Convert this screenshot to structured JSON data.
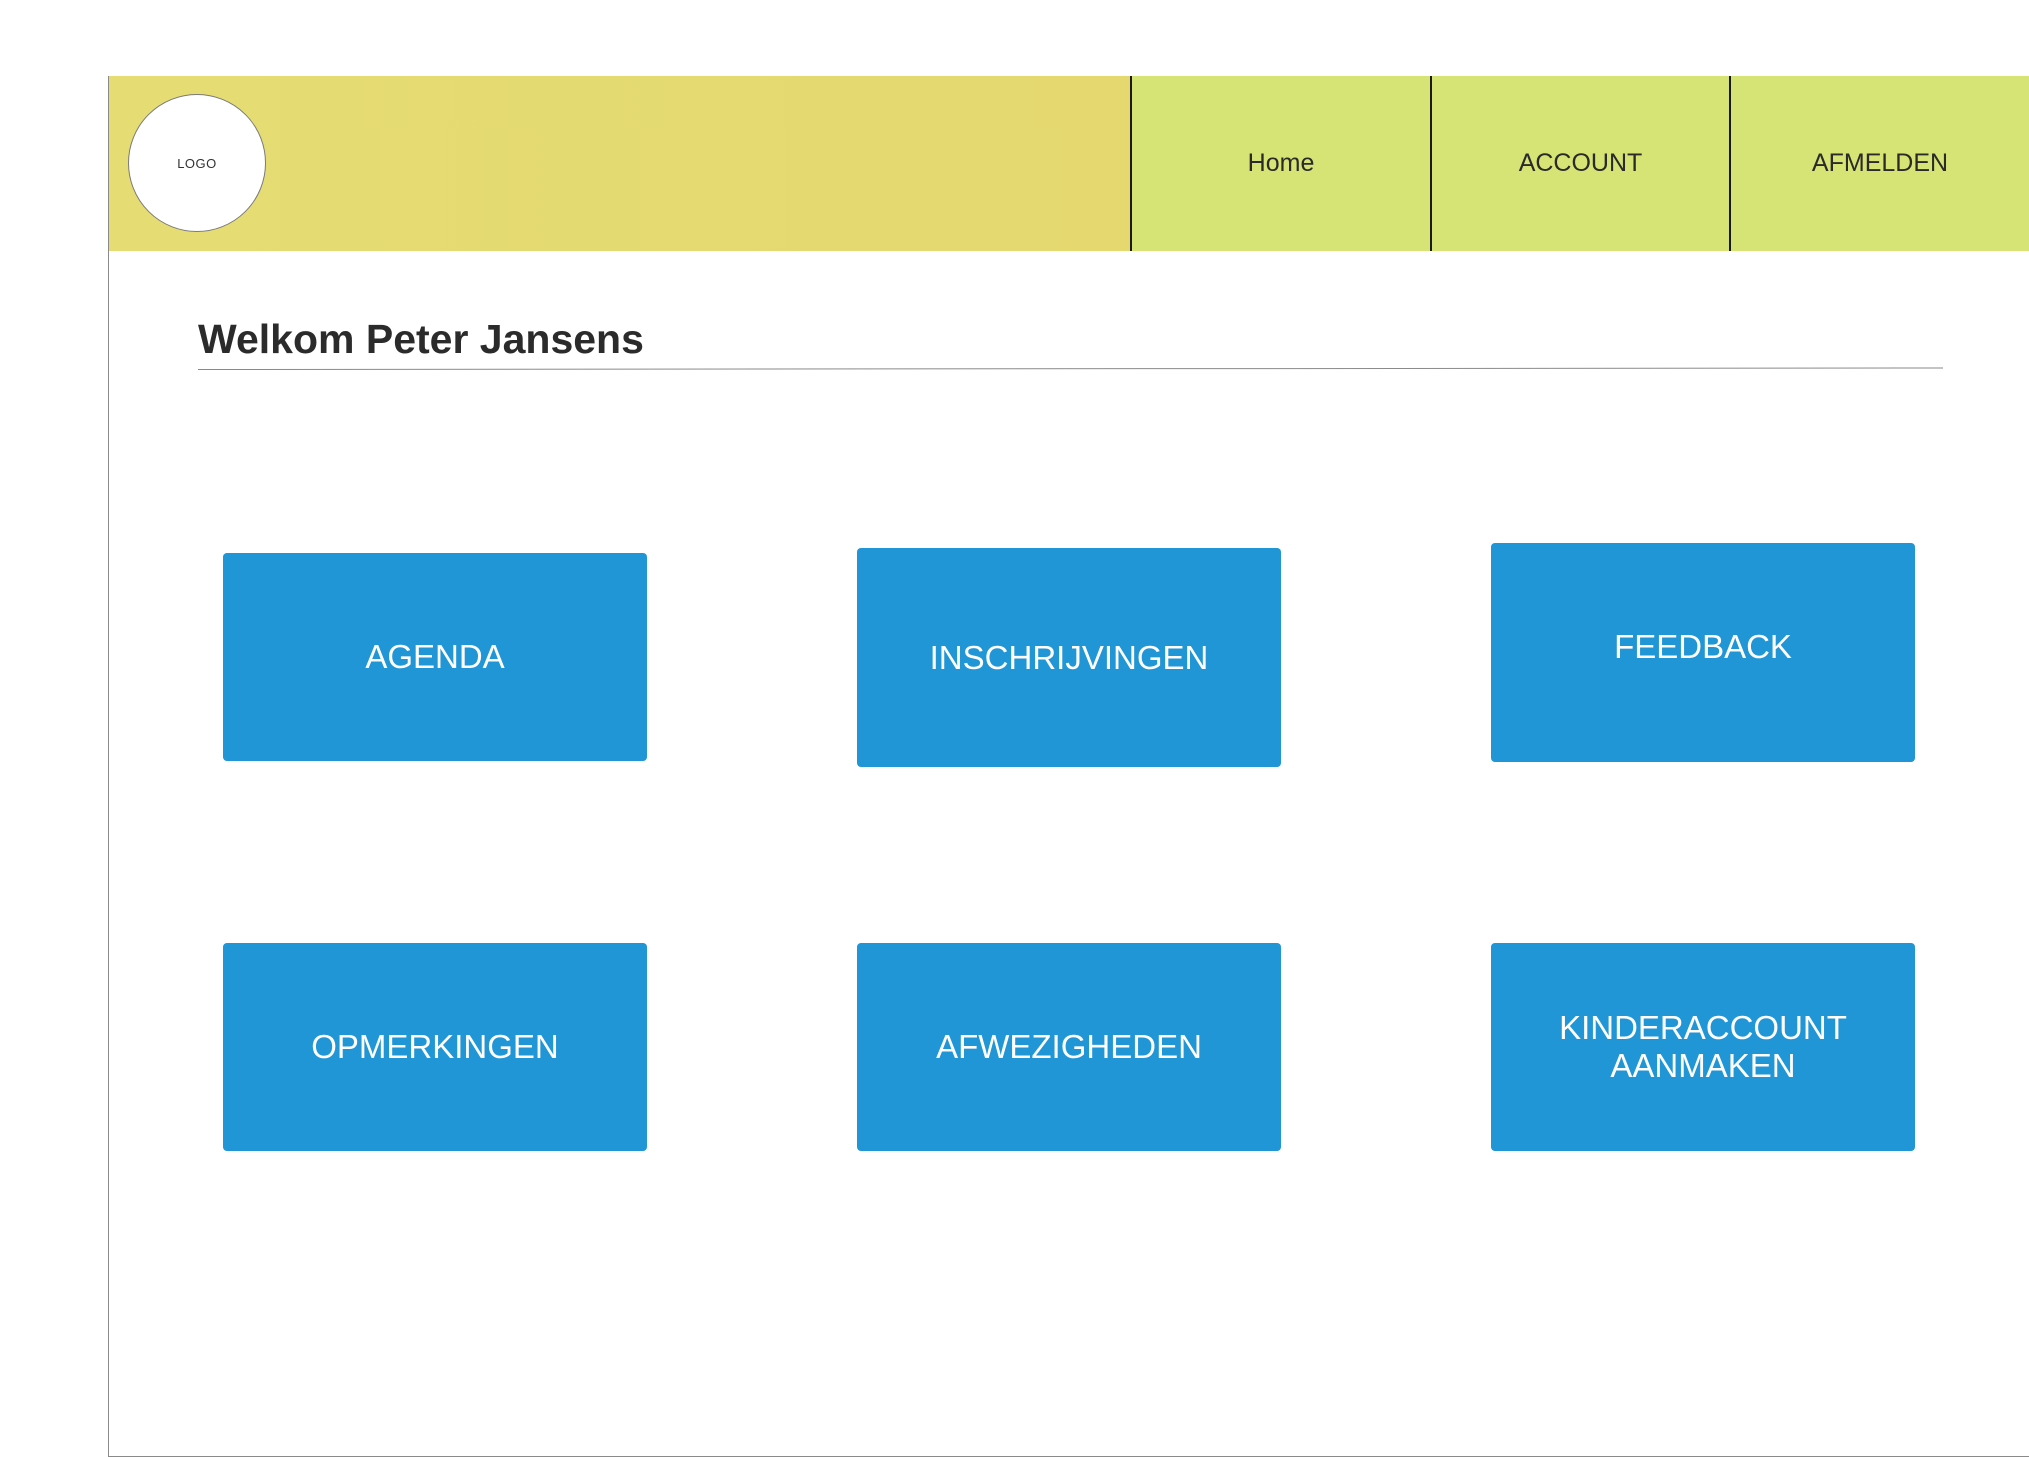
{
  "header": {
    "logo_label": "LOGO",
    "nav": [
      {
        "label": "Home"
      },
      {
        "label": "ACCOUNT"
      },
      {
        "label": "AFMELDEN"
      }
    ]
  },
  "main": {
    "welcome": "Welkom Peter Jansens",
    "tiles": [
      {
        "label": "AGENDA"
      },
      {
        "label": "INSCHRIJVINGEN"
      },
      {
        "label": "FEEDBACK"
      },
      {
        "label": "OPMERKINGEN"
      },
      {
        "label": "AFWEZIGHEDEN"
      },
      {
        "label": "KINDERACCOUNT\nAANMAKEN"
      }
    ]
  },
  "colors": {
    "header_left": "#e4d96f",
    "nav_background": "#d6e375",
    "tile_background": "#2196d6",
    "tile_text": "#ffffff"
  }
}
